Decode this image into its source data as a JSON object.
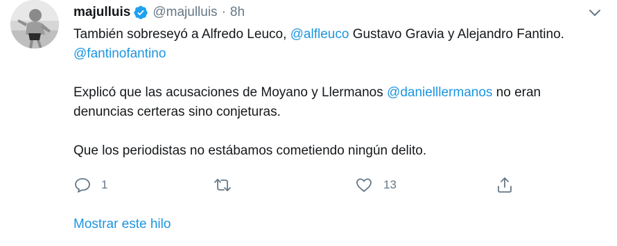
{
  "tweet": {
    "display_name": "majulluis",
    "handle": "@majulluis",
    "separator": "·",
    "time": "8h",
    "verified": true,
    "paragraph1": {
      "t1": "También sobreseyó a Alfredo Leuco, ",
      "m1": "@alfleuco",
      "t2": " Gustavo Gravia y Alejandro Fantino. ",
      "m2": "@fantinofantino"
    },
    "paragraph2": {
      "t1": "Explicó que las acusaciones de Moyano y Llermanos ",
      "m1": "@danielllermanos",
      "t2": " no eran denuncias certeras sino conjeturas."
    },
    "paragraph3": {
      "t1": "Que los periodistas no estábamos cometiendo ningún delito."
    },
    "actions": {
      "reply_icon": "speech-bubble-icon",
      "reply_count": "1",
      "retweet_icon": "retweet-icon",
      "like_icon": "heart-icon",
      "like_count": "13",
      "share_icon": "share-icon"
    },
    "show_thread": "Mostrar este hilo",
    "colors": {
      "link": "#1b95e0",
      "muted": "#657786",
      "text": "#14171a",
      "verified": "#1da1f2"
    }
  }
}
